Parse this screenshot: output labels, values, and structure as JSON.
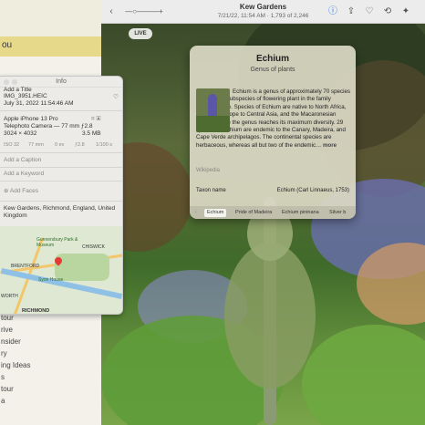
{
  "toolbar": {
    "title": "Kew Gardens",
    "subtitle": "7/21/22, 11:54 AM  ·  1,793 of 2,246"
  },
  "live_badge": "LIVE",
  "left_pane": {
    "highlight_text": "ou",
    "list_items": [
      "tour",
      "rive",
      "nsider",
      "ry",
      "ing Ideas",
      "s",
      "tour",
      "a"
    ]
  },
  "info_panel": {
    "header": "Info",
    "add_title": "Add a Title",
    "filename": "IMG_3951.HEIC",
    "datetime": "July 31, 2022   11:54:46 AM",
    "device": "Apple iPhone 13 Pro",
    "camera": "Telephoto Camera — 77 mm ƒ2.8",
    "resolution": "3024 × 4032",
    "filesize": "3.5 MB",
    "exif": [
      "ISO 32",
      "77 mm",
      "0 ev",
      "ƒ2.8",
      "1/100 s"
    ],
    "caption_placeholder": "Add a Caption",
    "keyword_placeholder": "Add a Keyword",
    "add_faces": "Add Faces",
    "location": "Kew Gardens, Richmond, England, United Kingdom",
    "map_labels": [
      "Gunnersbury Park & Museum",
      "CHISWICK",
      "BRENTFORD",
      "Syon House",
      "RICHMOND",
      "WORTH"
    ]
  },
  "knowledge_card": {
    "title": "Echium",
    "subtitle": "Genus of plants",
    "description": "Echium is a genus of approximately 70 species and several subspecies of flowering plant in the family Boraginaceae. Species of Echium are native to North Africa, mainland Europe to Central Asia, and the Macaronesian islands where the genus reaches its maximum diversity. 29 species of Echium are endemic to the Canary, Madeira, and Cape Verde archipelagos. The continental species are herbaceous, whereas all but two of the endemic…",
    "more_label": "more",
    "source": "Wikipedia",
    "row_label": "Taxon name",
    "row_value": "Echium (Carl Linnaeus, 1753)",
    "chips": [
      "Echium",
      "Pride of Madeira",
      "Echium pininana",
      "Silver b"
    ]
  },
  "colors": {
    "card_bg": "#dad8c4",
    "accent": "#1a73e8"
  }
}
